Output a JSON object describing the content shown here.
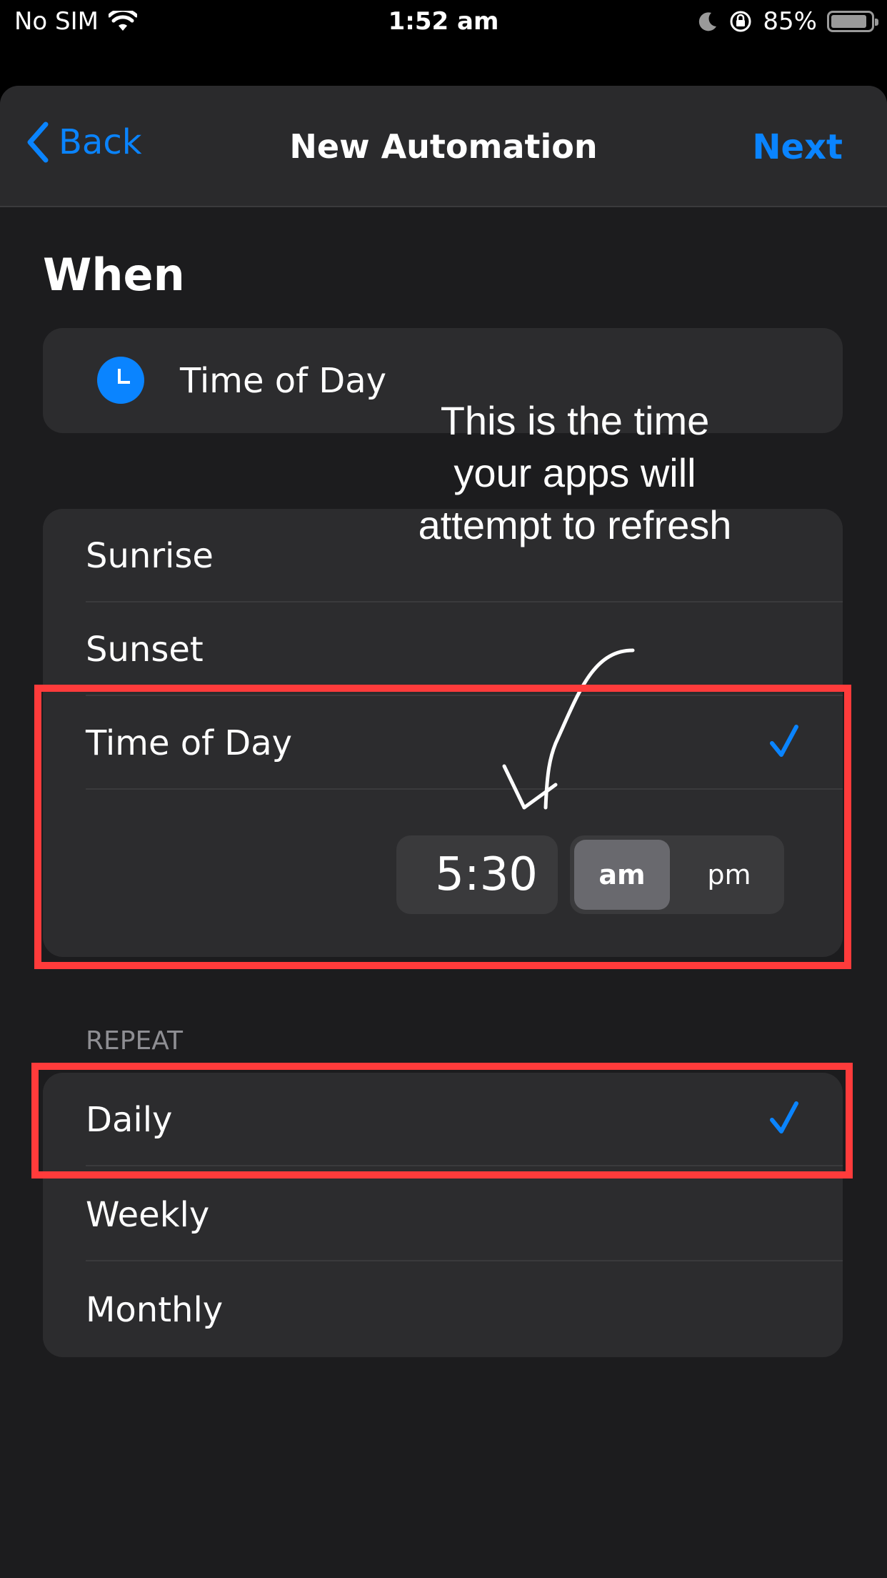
{
  "status_bar": {
    "carrier": "No SIM",
    "time": "1:52 am",
    "battery": "85%"
  },
  "nav": {
    "back_label": "Back",
    "title": "New Automation",
    "next_label": "Next"
  },
  "when": {
    "heading": "When",
    "trigger_label": "Time of Day",
    "options": [
      {
        "label": "Sunrise",
        "selected": false
      },
      {
        "label": "Sunset",
        "selected": false
      },
      {
        "label": "Time of Day",
        "selected": true
      }
    ],
    "time_value": "5:30",
    "period_options": [
      "am",
      "pm"
    ],
    "period_selected": "am"
  },
  "repeat": {
    "header": "REPEAT",
    "options": [
      {
        "label": "Daily",
        "selected": true
      },
      {
        "label": "Weekly",
        "selected": false
      },
      {
        "label": "Monthly",
        "selected": false
      }
    ]
  },
  "annotation": {
    "text_lines": [
      "This is the time",
      "your apps will",
      "attempt to refresh"
    ]
  },
  "colors": {
    "accent": "#0a84ff",
    "highlight_box": "#ff3b3b",
    "background": "#1c1c1e",
    "card": "#2c2c2e"
  },
  "icons": [
    "wifi-icon",
    "moon-icon",
    "rotation-lock-icon",
    "battery-icon",
    "chevron-left-icon",
    "clock-icon",
    "checkmark-icon",
    "arrow-icon"
  ]
}
